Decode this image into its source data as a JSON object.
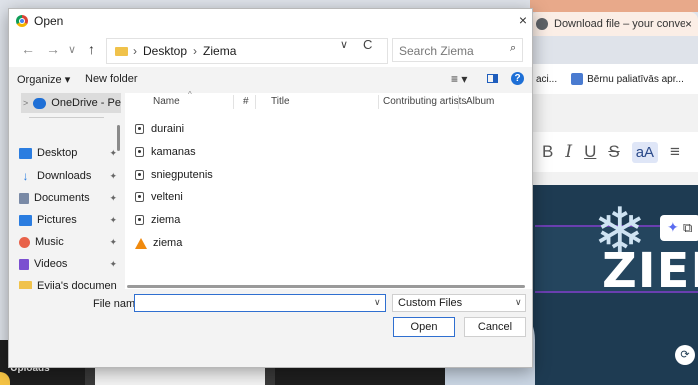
{
  "background": {
    "tab_title": "Download file – your conversion",
    "tab_close": "×",
    "bookmark_1": "aci...",
    "bookmark_2": "Bērnu paliatīvās apr...",
    "format_bold": "B",
    "format_italic": "I",
    "format_underline": "U",
    "format_strike": "S",
    "format_case": "aA",
    "format_align": "≡",
    "canvas_word": "ZIEM",
    "uploads_label": "Uploads"
  },
  "dialog": {
    "title": "Open",
    "close": "×",
    "nav": {
      "back": "←",
      "forward": "→",
      "recent": "∨",
      "up": "↑"
    },
    "address": {
      "root_chevron": "›",
      "crumbs": [
        "Desktop",
        "Ziema"
      ],
      "separator": "›",
      "dropdown": "∨",
      "refresh": "C"
    },
    "search": {
      "placeholder": "Search Ziema"
    },
    "commands": {
      "organize": "Organize ▾",
      "new_folder": "New folder",
      "view": "≡ ▾",
      "help": "?"
    },
    "sidebar": {
      "onedrive": "OneDrive - Perso",
      "onedrive_chevron": ">",
      "items": [
        {
          "label": "Desktop",
          "color": "#2b7de0"
        },
        {
          "label": "Downloads",
          "color": "#2b7de0"
        },
        {
          "label": "Documents",
          "color": "#7a8aa6"
        },
        {
          "label": "Pictures",
          "color": "#2b7de0"
        },
        {
          "label": "Music",
          "color": "#e8624a"
        },
        {
          "label": "Videos",
          "color": "#7b4fd0"
        },
        {
          "label": "Evija's documen",
          "color": "#f0c24b"
        }
      ],
      "pin": "✦"
    },
    "columns": [
      "Name",
      "#",
      "Title",
      "Contributing artists",
      "Album"
    ],
    "files": [
      {
        "name": "duraini",
        "kind": "audio"
      },
      {
        "name": "kamanas",
        "kind": "audio"
      },
      {
        "name": "sniegputenis",
        "kind": "audio"
      },
      {
        "name": "velteni",
        "kind": "audio"
      },
      {
        "name": "ziema",
        "kind": "audio"
      },
      {
        "name": "ziema",
        "kind": "vlc"
      }
    ],
    "filename_label": "File name:",
    "filename_value": "",
    "filetype": "Custom Files",
    "open_label": "Open",
    "cancel_label": "Cancel"
  }
}
